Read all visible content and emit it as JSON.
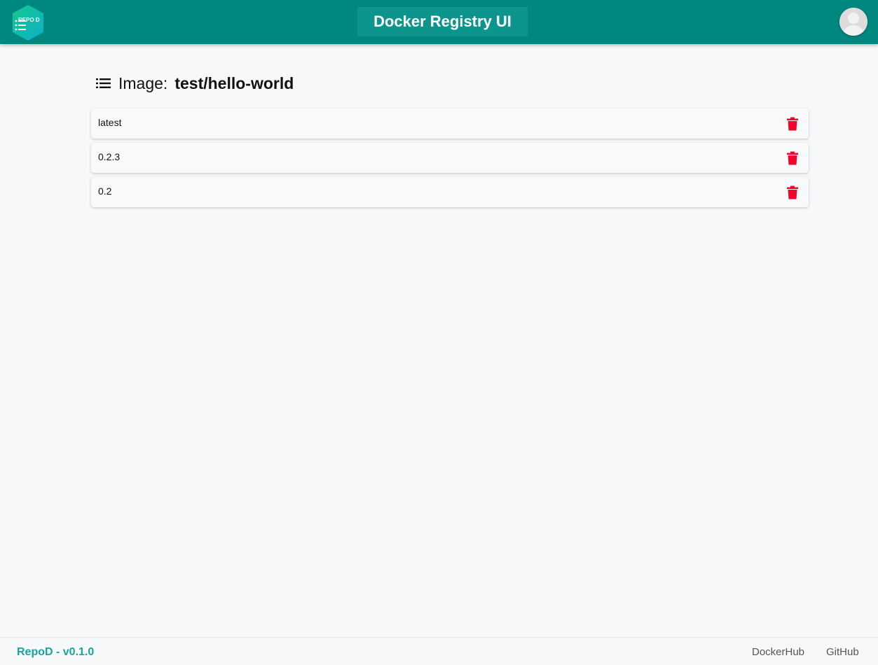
{
  "header": {
    "logo_text": "REPO D",
    "title": "Docker Registry UI"
  },
  "main": {
    "heading_prefix": "Image:",
    "image_name": "test/hello-world",
    "tags": [
      {
        "label": "latest"
      },
      {
        "label": "0.2.3"
      },
      {
        "label": "0.2"
      }
    ]
  },
  "footer": {
    "version": "RepoD - v0.1.0",
    "links": [
      {
        "label": "DockerHub"
      },
      {
        "label": "GitHub"
      }
    ]
  },
  "colors": {
    "topbar": "#00877f",
    "title_box": "#0d958d",
    "delete": "#f0062f",
    "footer_brand": "#1aa39a"
  },
  "icons": {
    "logo": "repod-hexagon-logo",
    "heading": "list-icon",
    "delete": "trash-icon",
    "avatar": "user-avatar-icon"
  }
}
